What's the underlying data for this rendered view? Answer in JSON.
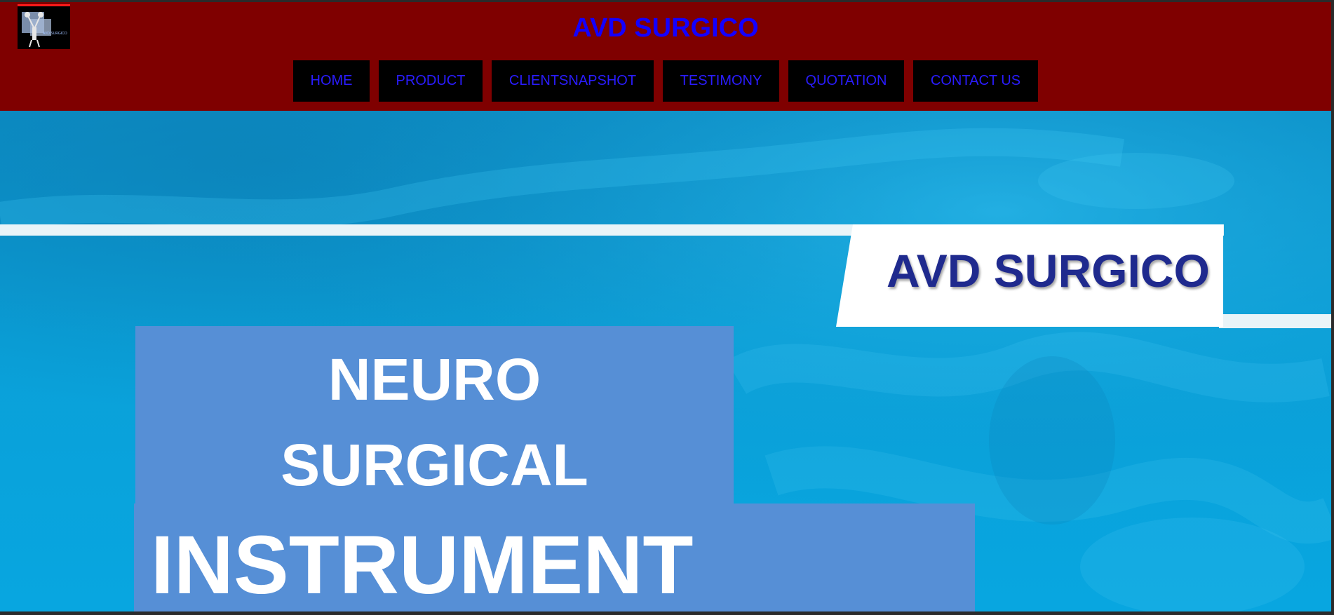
{
  "header": {
    "site_title": "AVD SURGICO",
    "logo_text": "AVD SURGICO",
    "colors": {
      "background": "#7f0000",
      "title": "#1400ff",
      "nav_background": "#000000",
      "nav_text": "#2a1cff"
    }
  },
  "nav": {
    "items": [
      {
        "label": "HOME"
      },
      {
        "label": "PRODUCT"
      },
      {
        "label": "CLIENTSNAPSHOT"
      },
      {
        "label": "TESTIMONY"
      },
      {
        "label": "QUOTATION"
      },
      {
        "label": "CONTACT US"
      }
    ]
  },
  "hero": {
    "brand": "AVD SURGICO",
    "line1": "NEURO",
    "line2": "SURGICAL",
    "line3": "INSTRUMENT",
    "colors": {
      "background": "#0aa0d8",
      "title_panel": "#568fd6",
      "brand_text": "#1f2a8e"
    }
  }
}
